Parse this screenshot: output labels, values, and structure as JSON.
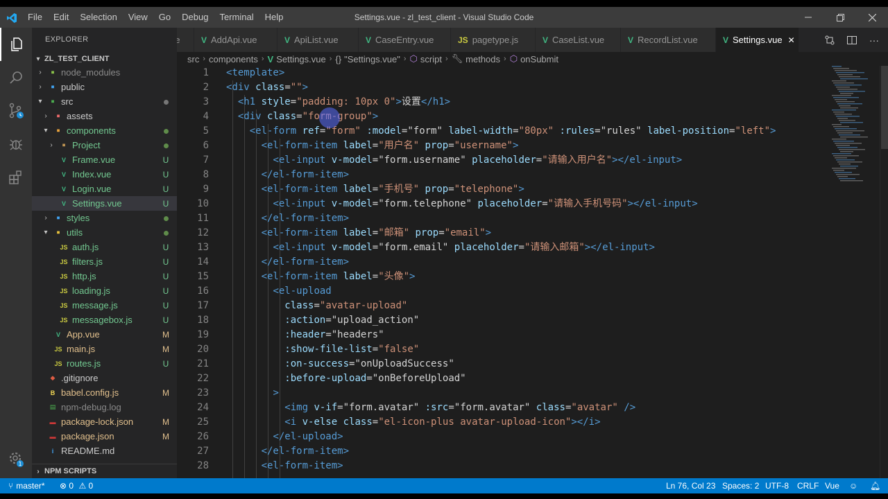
{
  "window": {
    "title": "Settings.vue - zl_test_client - Visual Studio Code",
    "menu": [
      "File",
      "Edit",
      "Selection",
      "View",
      "Go",
      "Debug",
      "Terminal",
      "Help"
    ]
  },
  "sidebar": {
    "header": "EXPLORER",
    "project": "ZL_TEST_CLIENT",
    "npm_scripts": "NPM SCRIPTS",
    "tree": [
      {
        "label": "node_modules",
        "depth": 1,
        "twist": "closed",
        "icon": "folder-node",
        "color": "#8a8a8a",
        "badge": ""
      },
      {
        "label": "public",
        "depth": 1,
        "twist": "closed",
        "icon": "folder-public",
        "color": "#cccccc",
        "badge": ""
      },
      {
        "label": "src",
        "depth": 1,
        "twist": "open",
        "icon": "folder-src",
        "color": "#cccccc",
        "badge": "dot"
      },
      {
        "label": "assets",
        "depth": 2,
        "twist": "closed",
        "icon": "folder-assets",
        "color": "#cccccc",
        "badge": ""
      },
      {
        "label": "components",
        "depth": 2,
        "twist": "open",
        "icon": "folder-components",
        "color": "#73c991",
        "badge": "dot"
      },
      {
        "label": "Project",
        "depth": 3,
        "twist": "closed",
        "icon": "folder",
        "color": "#73c991",
        "badge": "dot"
      },
      {
        "label": "Frame.vue",
        "depth": 3,
        "twist": "",
        "icon": "vue",
        "color": "#73c991",
        "badge": "U"
      },
      {
        "label": "Index.vue",
        "depth": 3,
        "twist": "",
        "icon": "vue",
        "color": "#73c991",
        "badge": "U"
      },
      {
        "label": "Login.vue",
        "depth": 3,
        "twist": "",
        "icon": "vue",
        "color": "#73c991",
        "badge": "U"
      },
      {
        "label": "Settings.vue",
        "depth": 3,
        "twist": "",
        "icon": "vue",
        "color": "#73c991",
        "badge": "U",
        "selected": true
      },
      {
        "label": "styles",
        "depth": 2,
        "twist": "closed",
        "icon": "folder-styles",
        "color": "#73c991",
        "badge": "dot"
      },
      {
        "label": "utils",
        "depth": 2,
        "twist": "open",
        "icon": "folder-utils",
        "color": "#73c991",
        "badge": "dot"
      },
      {
        "label": "auth.js",
        "depth": 3,
        "twist": "",
        "icon": "js",
        "color": "#73c991",
        "badge": "U"
      },
      {
        "label": "filters.js",
        "depth": 3,
        "twist": "",
        "icon": "js",
        "color": "#73c991",
        "badge": "U"
      },
      {
        "label": "http.js",
        "depth": 3,
        "twist": "",
        "icon": "js",
        "color": "#73c991",
        "badge": "U"
      },
      {
        "label": "loading.js",
        "depth": 3,
        "twist": "",
        "icon": "js",
        "color": "#73c991",
        "badge": "U"
      },
      {
        "label": "message.js",
        "depth": 3,
        "twist": "",
        "icon": "js",
        "color": "#73c991",
        "badge": "U"
      },
      {
        "label": "messagebox.js",
        "depth": 3,
        "twist": "",
        "icon": "js",
        "color": "#73c991",
        "badge": "U"
      },
      {
        "label": "App.vue",
        "depth": 2,
        "twist": "",
        "icon": "vue",
        "color": "#e2c08d",
        "badge": "M"
      },
      {
        "label": "main.js",
        "depth": 2,
        "twist": "",
        "icon": "js",
        "color": "#e2c08d",
        "badge": "M"
      },
      {
        "label": "routes.js",
        "depth": 2,
        "twist": "",
        "icon": "js",
        "color": "#73c991",
        "badge": "U"
      },
      {
        "label": ".gitignore",
        "depth": 1,
        "twist": "",
        "icon": "git",
        "color": "#cccccc",
        "badge": ""
      },
      {
        "label": "babel.config.js",
        "depth": 1,
        "twist": "",
        "icon": "babel",
        "color": "#e2c08d",
        "badge": "M"
      },
      {
        "label": "npm-debug.log",
        "depth": 1,
        "twist": "",
        "icon": "log",
        "color": "#8a8a8a",
        "badge": ""
      },
      {
        "label": "package-lock.json",
        "depth": 1,
        "twist": "",
        "icon": "npm",
        "color": "#e2c08d",
        "badge": "M"
      },
      {
        "label": "package.json",
        "depth": 1,
        "twist": "",
        "icon": "npm",
        "color": "#e2c08d",
        "badge": "M"
      },
      {
        "label": "README.md",
        "depth": 1,
        "twist": "",
        "icon": "readme",
        "color": "#cccccc",
        "badge": ""
      }
    ]
  },
  "tabs": [
    {
      "label": "ue",
      "icon": "",
      "active": false
    },
    {
      "label": "AddApi.vue",
      "icon": "vue",
      "active": false
    },
    {
      "label": "ApiList.vue",
      "icon": "vue",
      "active": false
    },
    {
      "label": "CaseEntry.vue",
      "icon": "vue",
      "active": false
    },
    {
      "label": "pagetype.js",
      "icon": "js",
      "active": false
    },
    {
      "label": "CaseList.vue",
      "icon": "vue",
      "active": false
    },
    {
      "label": "RecordList.vue",
      "icon": "vue",
      "active": false
    },
    {
      "label": "Settings.vue",
      "icon": "vue",
      "active": true
    }
  ],
  "breadcrumb": [
    "src",
    "components",
    "Settings.vue",
    "\"Settings.vue\"",
    "script",
    "methods",
    "onSubmit"
  ],
  "code": [
    [
      [
        "tk-tag",
        "<template>"
      ]
    ],
    [
      [
        "tk-tag",
        "<div"
      ],
      [
        "tk-text",
        " "
      ],
      [
        "tk-attr",
        "class"
      ],
      [
        "tk-text",
        "="
      ],
      [
        "tk-str",
        "\"\""
      ],
      [
        "tk-tag",
        ">"
      ]
    ],
    [
      [
        "tk-text",
        "  "
      ],
      [
        "tk-tag",
        "<h1"
      ],
      [
        "tk-text",
        " "
      ],
      [
        "tk-attr",
        "style"
      ],
      [
        "tk-text",
        "="
      ],
      [
        "tk-str",
        "\"padding: 10px 0\""
      ],
      [
        "tk-tag",
        ">"
      ],
      [
        "tk-text",
        "设置"
      ],
      [
        "tk-tag",
        "</h1>"
      ]
    ],
    [
      [
        "tk-text",
        "  "
      ],
      [
        "tk-tag",
        "<div"
      ],
      [
        "tk-text",
        " "
      ],
      [
        "tk-attr",
        "class"
      ],
      [
        "tk-text",
        "="
      ],
      [
        "tk-str",
        "\"form-group\""
      ],
      [
        "tk-tag",
        ">"
      ]
    ],
    [
      [
        "tk-text",
        "    "
      ],
      [
        "tk-tag",
        "<el-form"
      ],
      [
        "tk-text",
        " "
      ],
      [
        "tk-attr",
        "ref"
      ],
      [
        "tk-text",
        "="
      ],
      [
        "tk-str",
        "\"form\""
      ],
      [
        "tk-text",
        " "
      ],
      [
        "tk-attr",
        ":model"
      ],
      [
        "tk-text",
        "="
      ],
      [
        "tk-text",
        "\"form\""
      ],
      [
        "tk-text",
        " "
      ],
      [
        "tk-attr",
        "label-width"
      ],
      [
        "tk-text",
        "="
      ],
      [
        "tk-str",
        "\"80px\""
      ],
      [
        "tk-text",
        " "
      ],
      [
        "tk-attr",
        ":rules"
      ],
      [
        "tk-text",
        "="
      ],
      [
        "tk-text",
        "\"rules\""
      ],
      [
        "tk-text",
        " "
      ],
      [
        "tk-attr",
        "label-position"
      ],
      [
        "tk-text",
        "="
      ],
      [
        "tk-str",
        "\"left\""
      ],
      [
        "tk-tag",
        ">"
      ]
    ],
    [
      [
        "tk-text",
        "      "
      ],
      [
        "tk-tag",
        "<el-form-item"
      ],
      [
        "tk-text",
        " "
      ],
      [
        "tk-attr",
        "label"
      ],
      [
        "tk-text",
        "="
      ],
      [
        "tk-str",
        "\"用户名\""
      ],
      [
        "tk-text",
        " "
      ],
      [
        "tk-attr",
        "prop"
      ],
      [
        "tk-text",
        "="
      ],
      [
        "tk-str",
        "\"username\""
      ],
      [
        "tk-tag",
        ">"
      ]
    ],
    [
      [
        "tk-text",
        "        "
      ],
      [
        "tk-tag",
        "<el-input"
      ],
      [
        "tk-text",
        " "
      ],
      [
        "tk-attr",
        "v-model"
      ],
      [
        "tk-text",
        "="
      ],
      [
        "tk-text",
        "\"form.username\""
      ],
      [
        "tk-text",
        " "
      ],
      [
        "tk-attr",
        "placeholder"
      ],
      [
        "tk-text",
        "="
      ],
      [
        "tk-str",
        "\"请输入用户名\""
      ],
      [
        "tk-tag",
        "></el-input>"
      ]
    ],
    [
      [
        "tk-text",
        "      "
      ],
      [
        "tk-tag",
        "</el-form-item>"
      ]
    ],
    [
      [
        "tk-text",
        "      "
      ],
      [
        "tk-tag",
        "<el-form-item"
      ],
      [
        "tk-text",
        " "
      ],
      [
        "tk-attr",
        "label"
      ],
      [
        "tk-text",
        "="
      ],
      [
        "tk-str",
        "\"手机号\""
      ],
      [
        "tk-text",
        " "
      ],
      [
        "tk-attr",
        "prop"
      ],
      [
        "tk-text",
        "="
      ],
      [
        "tk-str",
        "\"telephone\""
      ],
      [
        "tk-tag",
        ">"
      ]
    ],
    [
      [
        "tk-text",
        "        "
      ],
      [
        "tk-tag",
        "<el-input"
      ],
      [
        "tk-text",
        " "
      ],
      [
        "tk-attr",
        "v-model"
      ],
      [
        "tk-text",
        "="
      ],
      [
        "tk-text",
        "\"form.telephone\""
      ],
      [
        "tk-text",
        " "
      ],
      [
        "tk-attr",
        "placeholder"
      ],
      [
        "tk-text",
        "="
      ],
      [
        "tk-str",
        "\"请输入手机号码\""
      ],
      [
        "tk-tag",
        "></el-input>"
      ]
    ],
    [
      [
        "tk-text",
        "      "
      ],
      [
        "tk-tag",
        "</el-form-item>"
      ]
    ],
    [
      [
        "tk-text",
        "      "
      ],
      [
        "tk-tag",
        "<el-form-item"
      ],
      [
        "tk-text",
        " "
      ],
      [
        "tk-attr",
        "label"
      ],
      [
        "tk-text",
        "="
      ],
      [
        "tk-str",
        "\"邮箱\""
      ],
      [
        "tk-text",
        " "
      ],
      [
        "tk-attr",
        "prop"
      ],
      [
        "tk-text",
        "="
      ],
      [
        "tk-str",
        "\"email\""
      ],
      [
        "tk-tag",
        ">"
      ]
    ],
    [
      [
        "tk-text",
        "        "
      ],
      [
        "tk-tag",
        "<el-input"
      ],
      [
        "tk-text",
        " "
      ],
      [
        "tk-attr",
        "v-model"
      ],
      [
        "tk-text",
        "="
      ],
      [
        "tk-text",
        "\"form.email\""
      ],
      [
        "tk-text",
        " "
      ],
      [
        "tk-attr",
        "placeholder"
      ],
      [
        "tk-text",
        "="
      ],
      [
        "tk-str",
        "\"请输入邮箱\""
      ],
      [
        "tk-tag",
        "></el-input>"
      ]
    ],
    [
      [
        "tk-text",
        "      "
      ],
      [
        "tk-tag",
        "</el-form-item>"
      ]
    ],
    [
      [
        "tk-text",
        "      "
      ],
      [
        "tk-tag",
        "<el-form-item"
      ],
      [
        "tk-text",
        " "
      ],
      [
        "tk-attr",
        "label"
      ],
      [
        "tk-text",
        "="
      ],
      [
        "tk-str",
        "\"头像\""
      ],
      [
        "tk-tag",
        ">"
      ]
    ],
    [
      [
        "tk-text",
        "        "
      ],
      [
        "tk-tag",
        "<el-upload"
      ]
    ],
    [
      [
        "tk-text",
        "          "
      ],
      [
        "tk-attr",
        "class"
      ],
      [
        "tk-text",
        "="
      ],
      [
        "tk-str",
        "\"avatar-upload\""
      ]
    ],
    [
      [
        "tk-text",
        "          "
      ],
      [
        "tk-attr",
        ":action"
      ],
      [
        "tk-text",
        "="
      ],
      [
        "tk-text",
        "\"upload_action\""
      ]
    ],
    [
      [
        "tk-text",
        "          "
      ],
      [
        "tk-attr",
        ":header"
      ],
      [
        "tk-text",
        "="
      ],
      [
        "tk-text",
        "\"headers\""
      ]
    ],
    [
      [
        "tk-text",
        "          "
      ],
      [
        "tk-attr",
        ":show-file-list"
      ],
      [
        "tk-text",
        "="
      ],
      [
        "tk-str",
        "\"false\""
      ]
    ],
    [
      [
        "tk-text",
        "          "
      ],
      [
        "tk-attr",
        ":on-success"
      ],
      [
        "tk-text",
        "="
      ],
      [
        "tk-text",
        "\"onUploadSuccess\""
      ]
    ],
    [
      [
        "tk-text",
        "          "
      ],
      [
        "tk-attr",
        ":before-upload"
      ],
      [
        "tk-text",
        "="
      ],
      [
        "tk-text",
        "\"onBeforeUpload\""
      ]
    ],
    [
      [
        "tk-text",
        "        "
      ],
      [
        "tk-tag",
        ">"
      ]
    ],
    [
      [
        "tk-text",
        "          "
      ],
      [
        "tk-tag",
        "<img"
      ],
      [
        "tk-text",
        " "
      ],
      [
        "tk-attr",
        "v-if"
      ],
      [
        "tk-text",
        "="
      ],
      [
        "tk-text",
        "\"form.avatar\""
      ],
      [
        "tk-text",
        " "
      ],
      [
        "tk-attr",
        ":src"
      ],
      [
        "tk-text",
        "="
      ],
      [
        "tk-text",
        "\"form.avatar\""
      ],
      [
        "tk-text",
        " "
      ],
      [
        "tk-attr",
        "class"
      ],
      [
        "tk-text",
        "="
      ],
      [
        "tk-str",
        "\"avatar\""
      ],
      [
        "tk-text",
        " "
      ],
      [
        "tk-tag",
        "/>"
      ]
    ],
    [
      [
        "tk-text",
        "          "
      ],
      [
        "tk-tag",
        "<i"
      ],
      [
        "tk-text",
        " "
      ],
      [
        "tk-attr",
        "v-else"
      ],
      [
        "tk-text",
        " "
      ],
      [
        "tk-attr",
        "class"
      ],
      [
        "tk-text",
        "="
      ],
      [
        "tk-str",
        "\"el-icon-plus avatar-upload-icon\""
      ],
      [
        "tk-tag",
        "></i>"
      ]
    ],
    [
      [
        "tk-text",
        "        "
      ],
      [
        "tk-tag",
        "</el-upload>"
      ]
    ],
    [
      [
        "tk-text",
        "      "
      ],
      [
        "tk-tag",
        "</el-form-item>"
      ]
    ],
    [
      [
        "tk-text",
        "      "
      ],
      [
        "tk-tag",
        "<el-form-item>"
      ]
    ]
  ],
  "status": {
    "branch": "master*",
    "errors": "0",
    "warnings": "0",
    "position": "Ln 76, Col 23",
    "spaces": "Spaces: 2",
    "encoding": "UTF-8",
    "eol": "CRLF",
    "language": "Vue"
  }
}
